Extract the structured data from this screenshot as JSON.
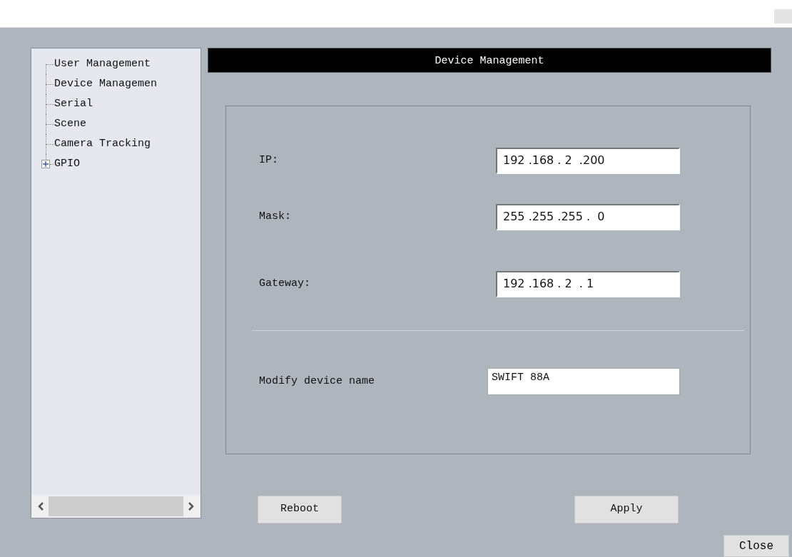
{
  "tree": {
    "items": [
      {
        "label": "User Management"
      },
      {
        "label": "Device Managemen"
      },
      {
        "label": "Serial"
      },
      {
        "label": "Scene"
      },
      {
        "label": "Camera Tracking"
      },
      {
        "label": "GPIO",
        "expanded": false
      }
    ]
  },
  "panel": {
    "title": "Device Management",
    "fields": [
      {
        "label": "IP:",
        "value": "192 .168 . 2  .200",
        "kind": "ip"
      },
      {
        "label": "Mask:",
        "value": "255 .255 .255 .  0",
        "kind": "ip"
      },
      {
        "label": "Gateway:",
        "value": "192 .168 . 2  . 1",
        "kind": "ip"
      },
      {
        "label": "Modify device name",
        "value": "SWIFT 88A",
        "kind": "text"
      }
    ]
  },
  "buttons": [
    "Reboot",
    "Apply"
  ],
  "close_button": "Close"
}
